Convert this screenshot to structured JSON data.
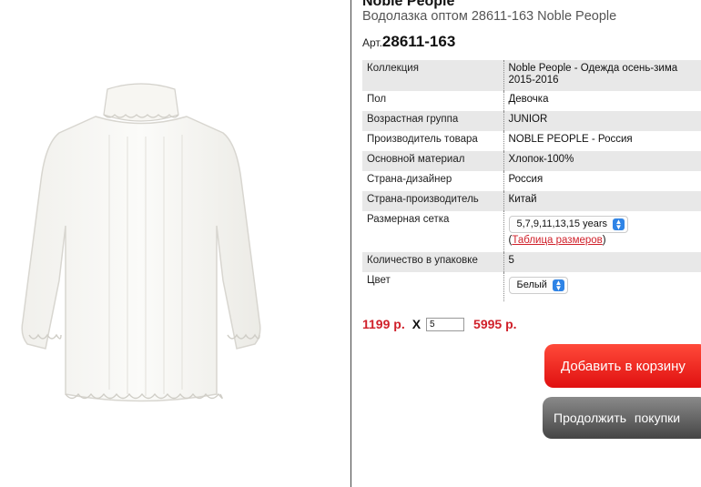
{
  "product": {
    "brand_title": "Noble People",
    "subtitle": "Водолазка оптом 28611-163 Noble People",
    "article_prefix": "Арт.",
    "article_number": "28611-163",
    "image_icon": "sweater-icon"
  },
  "specs": [
    {
      "label": "Коллекция",
      "value": "Noble People - Одежда осень-зима 2015-2016"
    },
    {
      "label": "Пол",
      "value": "Девочка"
    },
    {
      "label": "Возрастная группа",
      "value": "JUNIOR"
    },
    {
      "label": "Производитель товара",
      "value": "NOBLE PEOPLE - Россия"
    },
    {
      "label": "Основной материал",
      "value": "Хлопок-100%"
    },
    {
      "label": "Страна-дизайнер",
      "value": "Россия"
    },
    {
      "label": "Страна-производитель",
      "value": "Китай"
    },
    {
      "label": "Размерная сетка",
      "size_select": "5,7,9,11,13,15 years",
      "link_open": "(",
      "link_text": "Таблица размеров",
      "link_close": ")"
    },
    {
      "label": "Количество в упаковке",
      "value": "5"
    },
    {
      "label": "Цвет",
      "color_select": "Белый"
    }
  ],
  "order": {
    "price": "1199 р.",
    "times": "X",
    "quantity": "5",
    "total": "5995 р."
  },
  "buttons": {
    "add_to_cart": "Добавить в корзину",
    "continue_shopping": "Продолжить покупки"
  },
  "colors": {
    "accent_red": "#d0202a",
    "cart_button": "#ff2a1a",
    "continue_button": "#5a5a5a",
    "select_arrow": "#2f84e6"
  }
}
